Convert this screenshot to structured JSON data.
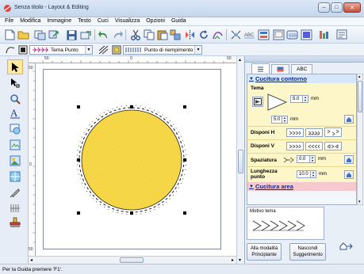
{
  "window": {
    "title": "Senza titolo - Layout & Editing",
    "minimize": "–",
    "maximize": "□",
    "close": "✕"
  },
  "menu": [
    "File",
    "Modifica",
    "Immagine",
    "Testo",
    "Cuci",
    "Visualizza",
    "Opzioni",
    "Guida"
  ],
  "toolbar2": {
    "line_stitch": "Tema Punto",
    "fill_stitch": "Punto di riempimento"
  },
  "rulers": {
    "top": [
      "50",
      "0",
      "50"
    ],
    "left": [
      "50",
      "0",
      "50"
    ]
  },
  "panel": {
    "tab_text": "ABC",
    "section_outline": "Cucitura contorno",
    "tema_label": "Tema",
    "size_value": "5.0",
    "size_unit": "mm",
    "spacing_value": "5.0",
    "spacing_unit": "mm",
    "arrange_h": "Disponi H",
    "arrange_v": "Disponi V",
    "spaziatura": "Spaziatura",
    "spaziatura_value": "0.0",
    "spaziatura_unit": "mm",
    "lunghezza": "Lunghezza",
    "punto": "punto",
    "lunghezza_value": "10.0",
    "lunghezza_unit": "mm",
    "section_area": "Cucitura area",
    "preview_label": "Motivo tema",
    "btn_main_l1": "Alla modalità",
    "btn_main_l2": "Principiante",
    "btn_hide_l1": "Nascondi",
    "btn_hide_l2": "Suggerimento"
  },
  "status": "Per la Guida premere 'F1'.",
  "colors": {
    "fill": "#f7d84a",
    "outline": "#111111",
    "accent": "#0d2c8a"
  }
}
